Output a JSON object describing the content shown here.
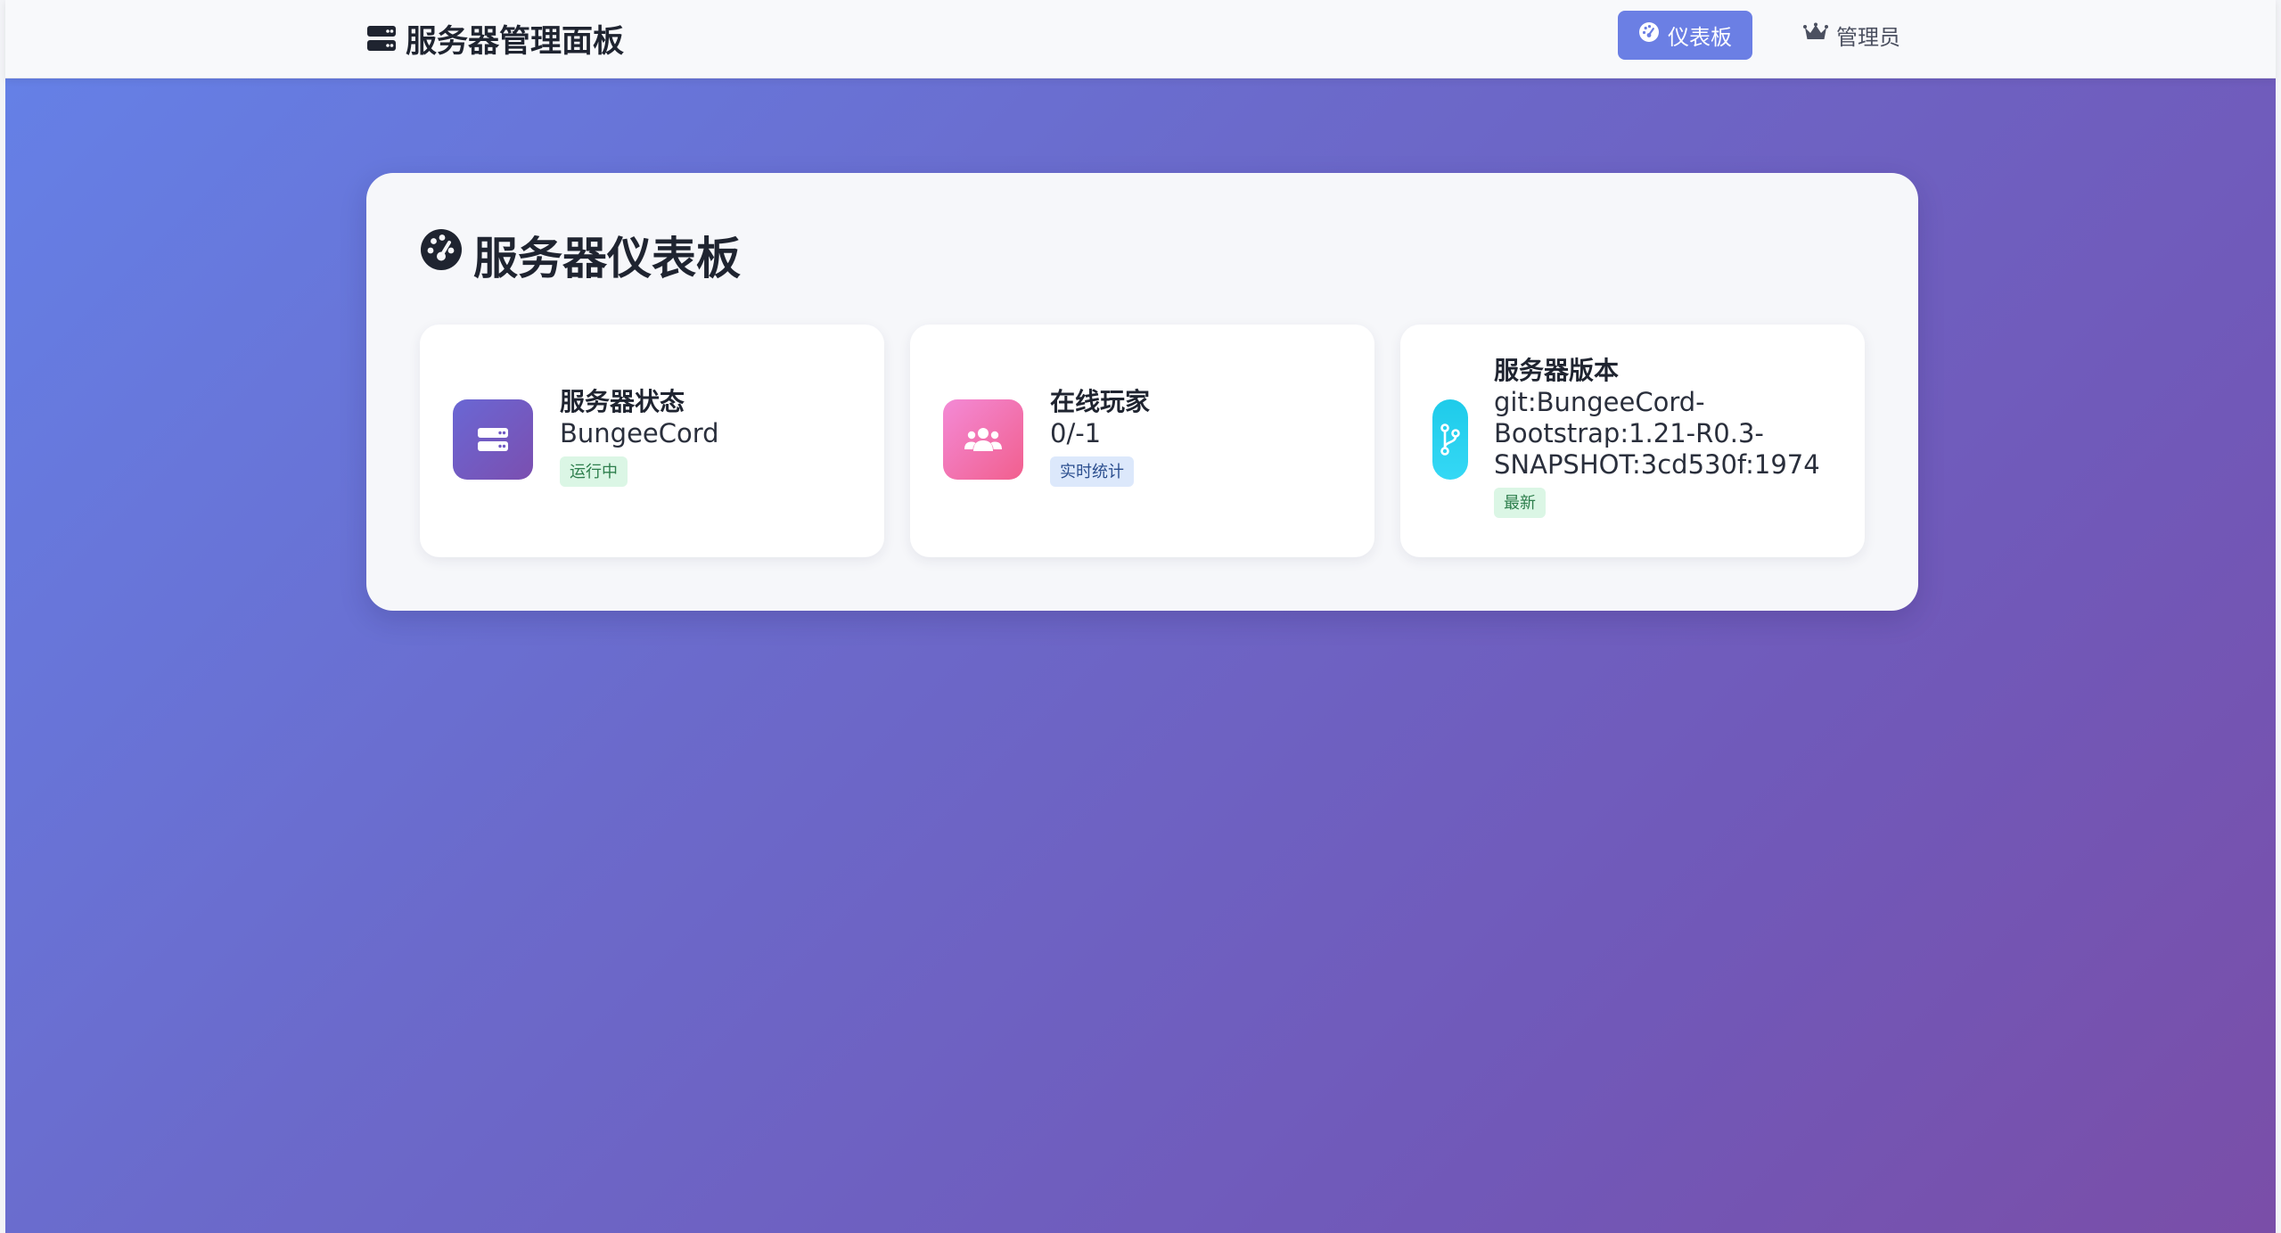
{
  "navbar": {
    "brand_icon": "server-icon",
    "brand_title": "服务器管理面板",
    "links": [
      {
        "label": "仪表板",
        "icon": "dashboard-icon",
        "active": true
      },
      {
        "label": "管理员",
        "icon": "crown-icon",
        "active": false
      }
    ]
  },
  "panel": {
    "title_icon": "dashboard-icon",
    "title": "服务器仪表板",
    "cards": [
      {
        "icon": "server-icon",
        "label": "服务器状态",
        "value": "BungeeCord",
        "badge": "运行中",
        "badge_color": "#2d7e4c"
      },
      {
        "icon": "users-icon",
        "label": "在线玩家",
        "value": "0/-1",
        "badge": "实时统计",
        "badge_color": "#2c4f8f"
      },
      {
        "icon": "code-branch-icon",
        "label": "服务器版本",
        "value": "git:BungeeCord-Bootstrap:1.21-R0.3-SNAPSHOT:3cd530f:1974",
        "value_lines": [
          "git:BungeeCord-",
          "Bootstrap:1.21-R0.3-",
          "SNAPSHOT:3cd530f:1974"
        ],
        "badge": "最新",
        "badge_color": "#2d7e4c"
      }
    ]
  },
  "colors": {
    "accent": "#6b7fe4",
    "gradient_start": "#6580e6",
    "gradient_end": "#7a4ea8",
    "card1_icon": "#7059c4",
    "card2_icon": "#f25f8e",
    "card3_icon": "#1ecbea"
  }
}
